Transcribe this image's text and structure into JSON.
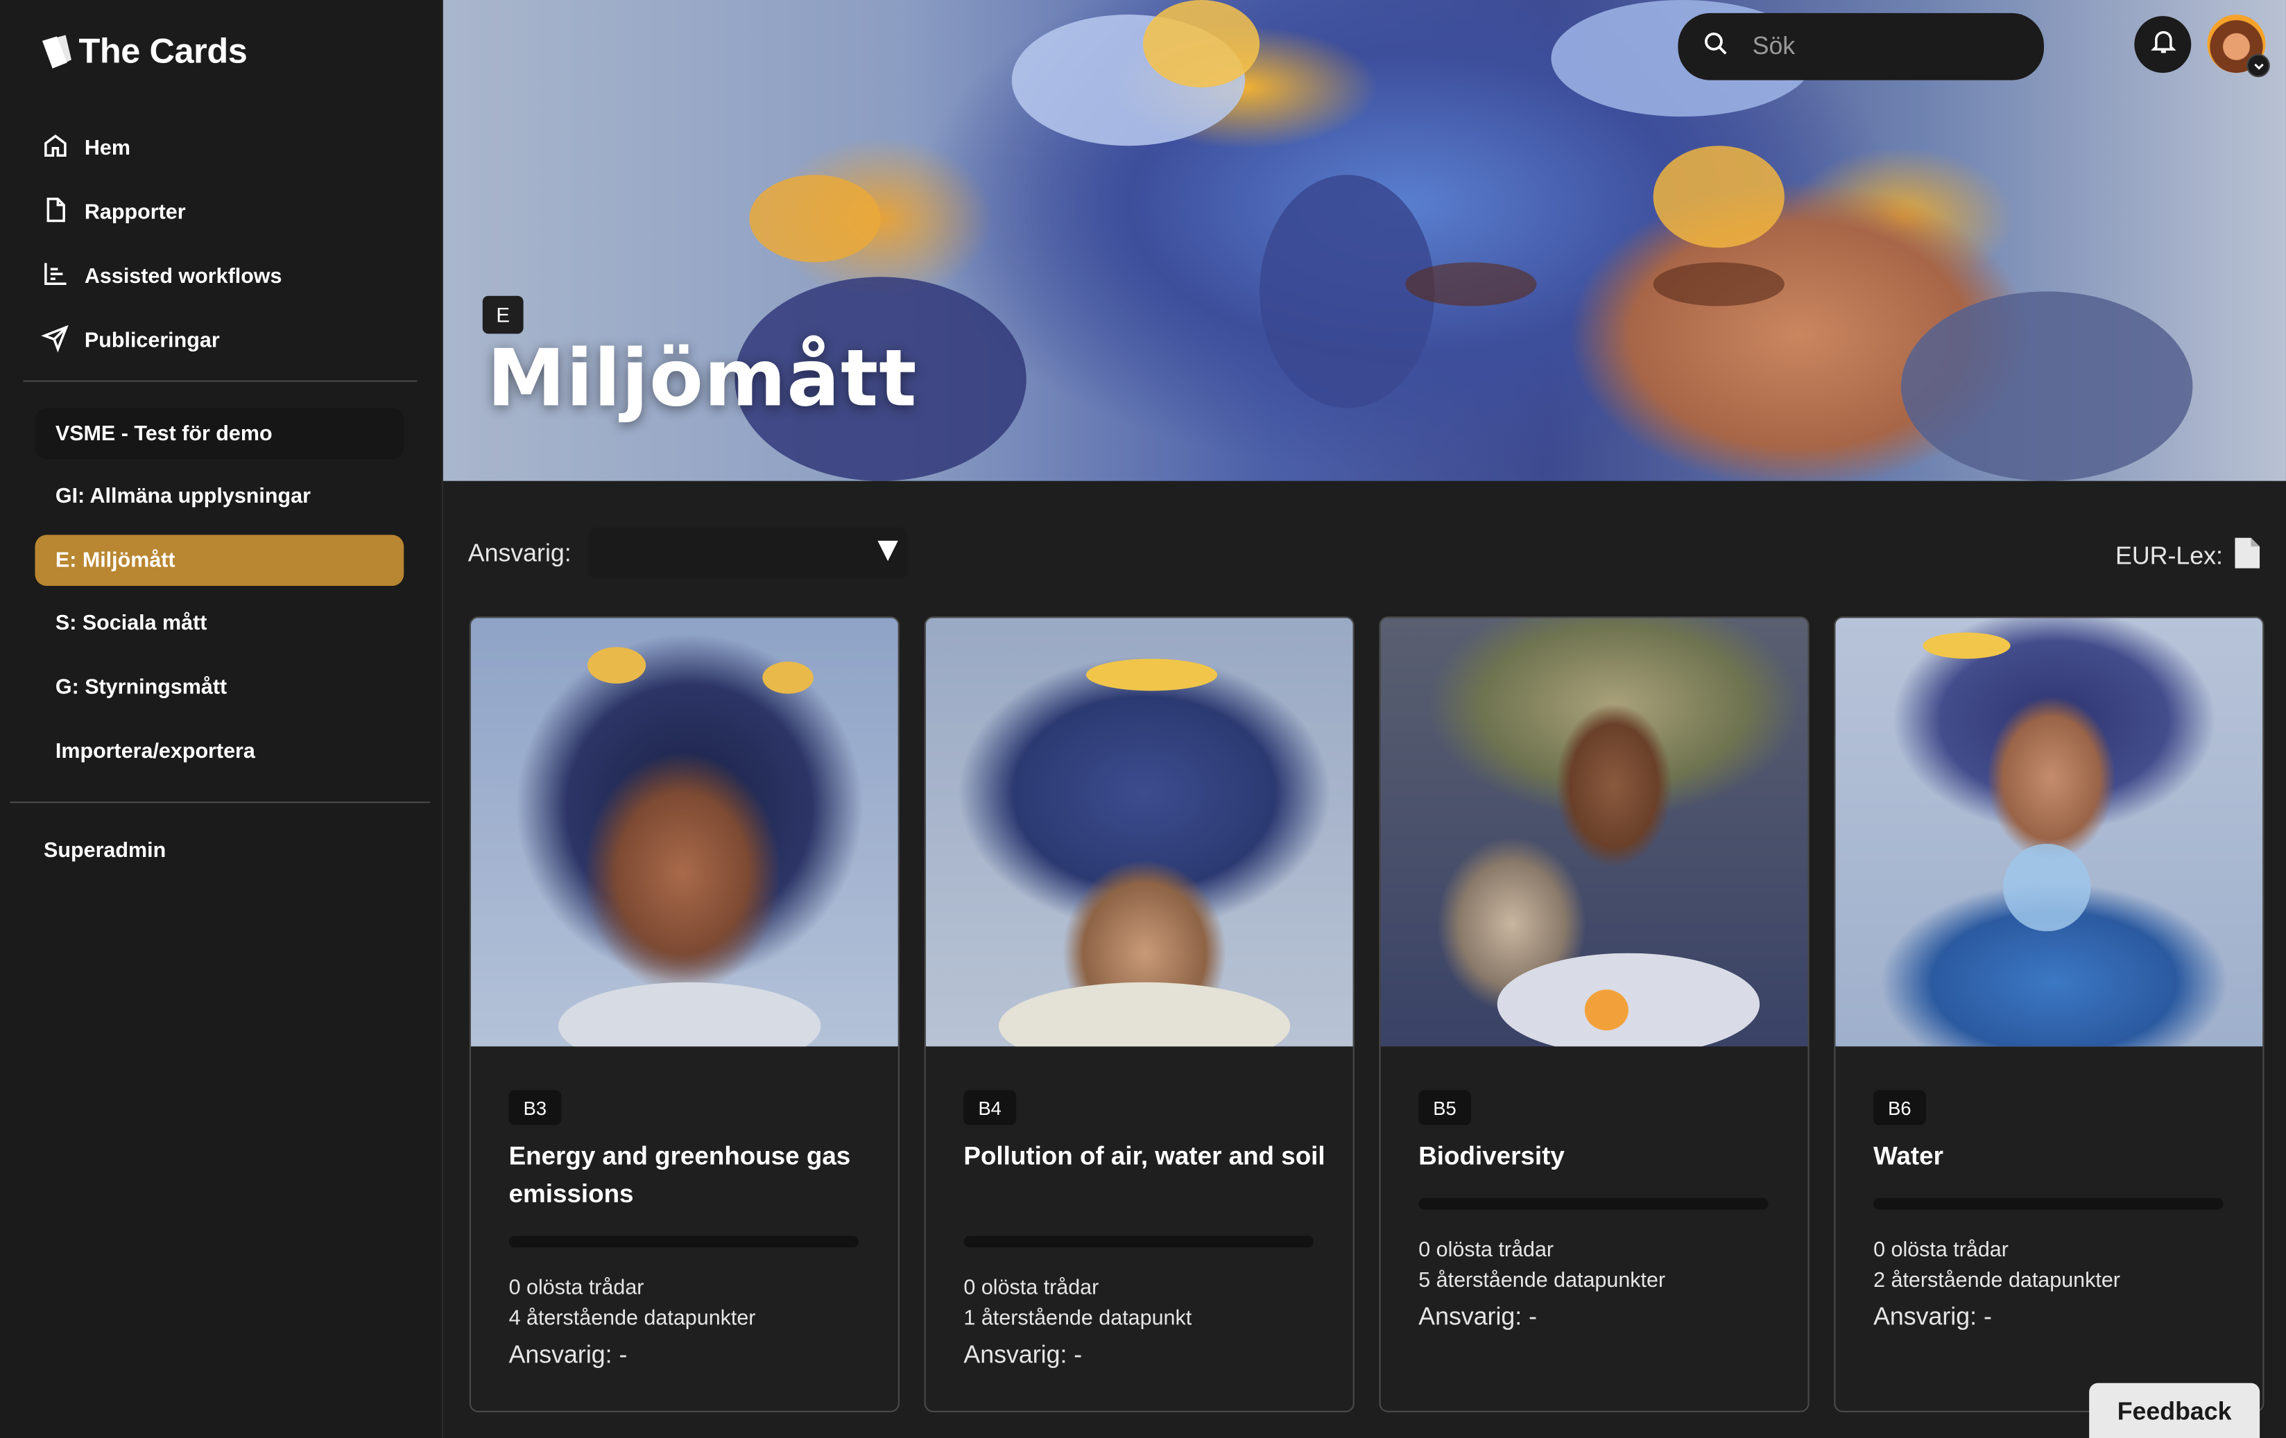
{
  "app": {
    "name": "The Cards",
    "logo_icon": "cards-logo-icon"
  },
  "nav": [
    {
      "label": "Hem",
      "icon": "home-icon"
    },
    {
      "label": "Rapporter",
      "icon": "document-icon"
    },
    {
      "label": "Assisted workflows",
      "icon": "chart-icon"
    },
    {
      "label": "Publiceringar",
      "icon": "send-icon"
    }
  ],
  "report_nav": [
    {
      "label": "VSME - Test för demo",
      "state": "header"
    },
    {
      "label": "GI: Allmäna upplysningar",
      "state": "normal"
    },
    {
      "label": "E: Miljömått",
      "state": "active"
    },
    {
      "label": "S: Sociala mått",
      "state": "normal"
    },
    {
      "label": "G: Styrningsmått",
      "state": "normal"
    },
    {
      "label": "Importera/exportera",
      "state": "normal"
    }
  ],
  "superadmin_label": "Superadmin",
  "search": {
    "placeholder": "Sök"
  },
  "hero": {
    "badge": "E",
    "title": "Miljömått"
  },
  "filter": {
    "label": "Ansvarig:",
    "selected": ""
  },
  "eurlex": {
    "label": "EUR-Lex:"
  },
  "cards": [
    {
      "tag": "B3",
      "title": "Energy and greenhouse gas emissions",
      "threads": "0 olösta trådar",
      "datapoints": "4 återstående datapunkter",
      "responsible": "Ansvarig: -"
    },
    {
      "tag": "B4",
      "title": "Pollution of air, water and soil",
      "threads": "0 olösta trådar",
      "datapoints": "1 återstående datapunkt",
      "responsible": "Ansvarig: -"
    },
    {
      "tag": "B5",
      "title": "Biodiversity",
      "threads": "0 olösta trådar",
      "datapoints": "5 återstående datapunkter",
      "responsible": "Ansvarig: -"
    },
    {
      "tag": "B6",
      "title": "Water",
      "threads": "0 olösta trådar",
      "datapoints": "2 återstående datapunkter",
      "responsible": "Ansvarig: -"
    }
  ],
  "feedback_label": "Feedback",
  "colors": {
    "accent": "#b98631",
    "sidebar": "#1b1b1b",
    "background": "#1e1e1e"
  }
}
